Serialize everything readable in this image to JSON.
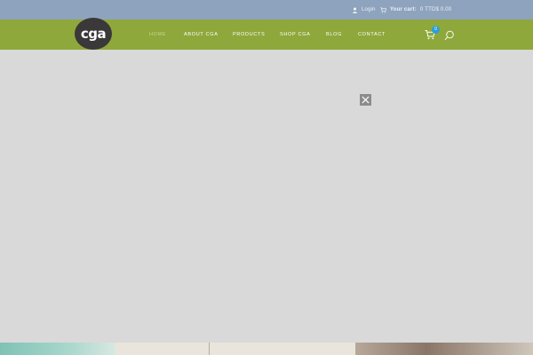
{
  "topbar": {
    "login_label": "Login",
    "cart_label": "Your cart:",
    "cart_value": "0 TTD$ 0.00"
  },
  "brand": {
    "logo_text": "cga",
    "colors": {
      "topbar": "#8ea3bd",
      "navbar": "#8fa83b",
      "logo_bg": "#3a3838",
      "badge": "#2a9fd6",
      "overlay": "#d9d9d9"
    }
  },
  "nav": {
    "items": [
      {
        "label": "HOME",
        "active": true
      },
      {
        "label": "ABOUT CGA",
        "active": false
      },
      {
        "label": "PRODUCTS",
        "active": false
      },
      {
        "label": "SHOP CGA",
        "active": false
      },
      {
        "label": "BLOG",
        "active": false
      },
      {
        "label": "CONTACT",
        "active": false
      }
    ],
    "cart_count": "0",
    "icons": [
      "cart-icon",
      "search-icon"
    ]
  },
  "overlay": {
    "close_icon": "close-icon"
  }
}
